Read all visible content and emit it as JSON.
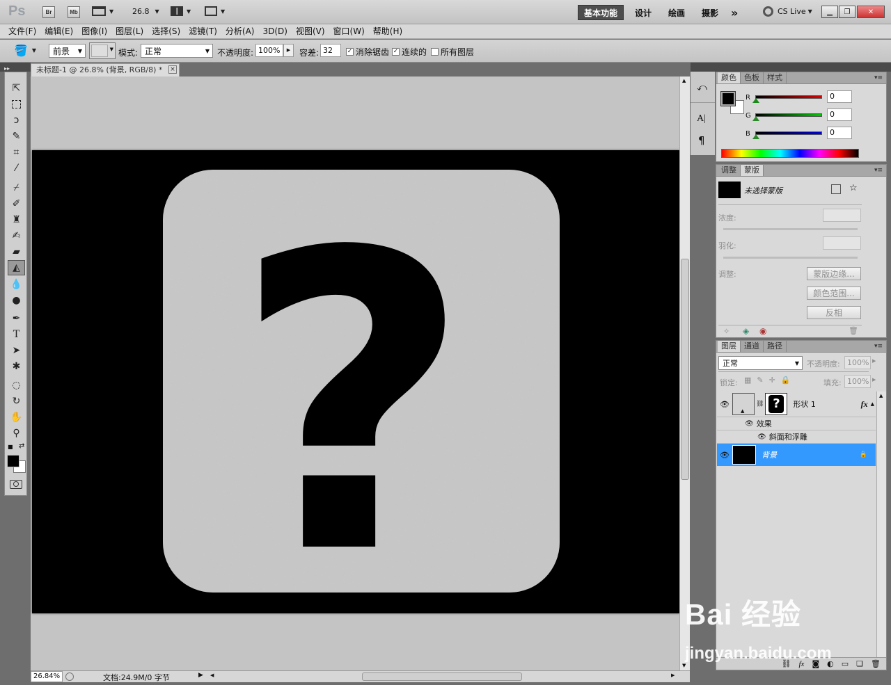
{
  "appbar": {
    "logo": "Ps",
    "br": "Br",
    "mb": "Mb",
    "zoom": "26.8",
    "workspaces": [
      "基本功能",
      "设计",
      "绘画",
      "摄影"
    ],
    "more": "»",
    "cslive": "CS Live"
  },
  "menu": {
    "items": [
      "文件(F)",
      "编辑(E)",
      "图像(I)",
      "图层(L)",
      "选择(S)",
      "滤镜(T)",
      "分析(A)",
      "3D(D)",
      "视图(V)",
      "窗口(W)",
      "帮助(H)"
    ]
  },
  "options": {
    "fill_source": "前景",
    "mode_label": "模式:",
    "mode_value": "正常",
    "opacity_label": "不透明度:",
    "opacity_value": "100%",
    "tolerance_label": "容差:",
    "tolerance_value": "32",
    "antialias_label": "消除锯齿",
    "contiguous_label": "连续的",
    "all_layers_label": "所有图层"
  },
  "document": {
    "tab_title": "未标题-1 @ 26.8% (背景, RGB/8) *",
    "close": "×"
  },
  "status": {
    "zoom": "26.84%",
    "doc_info": "文档:24.9M/0 字节"
  },
  "color_panel": {
    "tabs": [
      "颜色",
      "色板",
      "样式"
    ],
    "channels": [
      {
        "label": "R",
        "value": "0",
        "color": "#cc0000"
      },
      {
        "label": "G",
        "value": "0",
        "color": "#00aa00"
      },
      {
        "label": "B",
        "value": "0",
        "color": "#0000cc"
      }
    ]
  },
  "masks_panel": {
    "tabs": [
      "调整",
      "蒙版"
    ],
    "no_mask": "未选择蒙版",
    "density_label": "浓度:",
    "feather_label": "羽化:",
    "refine_label": "调整:",
    "btn_edge": "蒙版边缘...",
    "btn_color_range": "颜色范围...",
    "btn_invert": "反相"
  },
  "layers_panel": {
    "tabs": [
      "图层",
      "通道",
      "路径"
    ],
    "blend_mode": "正常",
    "opacity_label": "不透明度:",
    "opacity_value": "100%",
    "lock_label": "锁定:",
    "fill_label": "填充:",
    "fill_value": "100%",
    "layers": [
      {
        "name": "形状 1",
        "fx": "fx",
        "effects_label": "效果",
        "effect": "斜面和浮雕"
      },
      {
        "name": "背景",
        "selected": true
      }
    ]
  },
  "canvas": {
    "glyph": "?"
  },
  "watermark": {
    "brand": "Bai 经验",
    "url": "jingyan.baidu.com"
  },
  "colors": {
    "foreground": "#000000",
    "background": "#ffffff",
    "selected_layer": "#3399ff",
    "card": "#c9c9c9"
  }
}
